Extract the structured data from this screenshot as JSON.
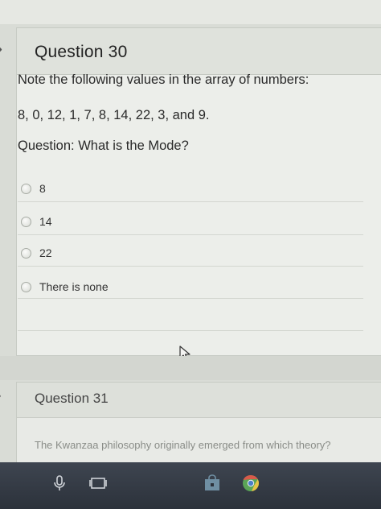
{
  "question30": {
    "title": "Question 30",
    "prompt_line1": "Note the following values in the array of numbers:",
    "prompt_line2": "8, 0, 12, 1, 7, 8, 14, 22, 3, and 9.",
    "prompt_line3": "Question:  What is the Mode?",
    "options": [
      {
        "label": "8",
        "selected": false
      },
      {
        "label": "14",
        "selected": false
      },
      {
        "label": "22",
        "selected": false
      },
      {
        "label": "There is none",
        "selected": false
      }
    ]
  },
  "question31": {
    "title": "Question 31",
    "prompt": "The Kwanzaa philosophy originally emerged from which theory?"
  },
  "taskbar": {
    "icons": [
      "microphone-icon",
      "task-view-icon",
      "store-icon",
      "chrome-icon"
    ]
  },
  "colors": {
    "background": "#d9dcd6",
    "card": "#eceeea",
    "header": "#dfe2dc",
    "taskbar": "#2c323b"
  }
}
